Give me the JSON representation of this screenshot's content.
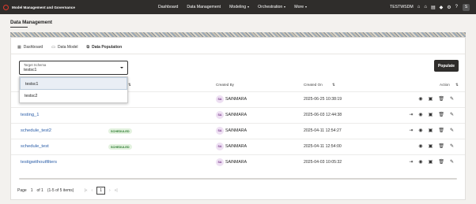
{
  "app": {
    "title": "Model Management and Governance"
  },
  "nav": {
    "items": [
      "Dashboard",
      "Data Management",
      "Modeling",
      "Orchestration",
      "More"
    ]
  },
  "topright": {
    "user": "TESTWSDM",
    "avatar": "S"
  },
  "page": {
    "title": "Data Management"
  },
  "tabs": [
    "Dashboard",
    "Data Model",
    "Data Population"
  ],
  "select": {
    "label": "Target Schema",
    "value": "testsc1",
    "options": [
      "testsc1",
      "testsc2"
    ]
  },
  "populate_label": "Populate",
  "table": {
    "headers": {
      "created_by": "Created By",
      "created_on": "Created On",
      "action": "Action"
    },
    "rows": [
      {
        "name": "",
        "status": "",
        "by_initials": "SA",
        "by": "SAINMARA",
        "date": "2025-06-25 10:38:19"
      },
      {
        "name": "testing_1",
        "status": "",
        "by_initials": "SA",
        "by": "SAINMARA",
        "date": "2025-06-03 12:44:38"
      },
      {
        "name": "schedule_test2",
        "status": "SCHEDULED",
        "by_initials": "SA",
        "by": "SAINMARA",
        "date": "2025-04-11 12:54:27"
      },
      {
        "name": "schedule_test",
        "status": "SCHEDULED",
        "by_initials": "SA",
        "by": "SAINMARA",
        "date": "2025-04-11 12:54:00"
      },
      {
        "name": "testigwithoutfilters",
        "status": "",
        "by_initials": "SA",
        "by": "SAINMARA",
        "date": "2025-04-03 10:05:32"
      }
    ]
  },
  "pager": {
    "page_label": "Page",
    "page": "1",
    "of": "of 1",
    "items": "(1-5 of 5 items)",
    "current": "1"
  }
}
